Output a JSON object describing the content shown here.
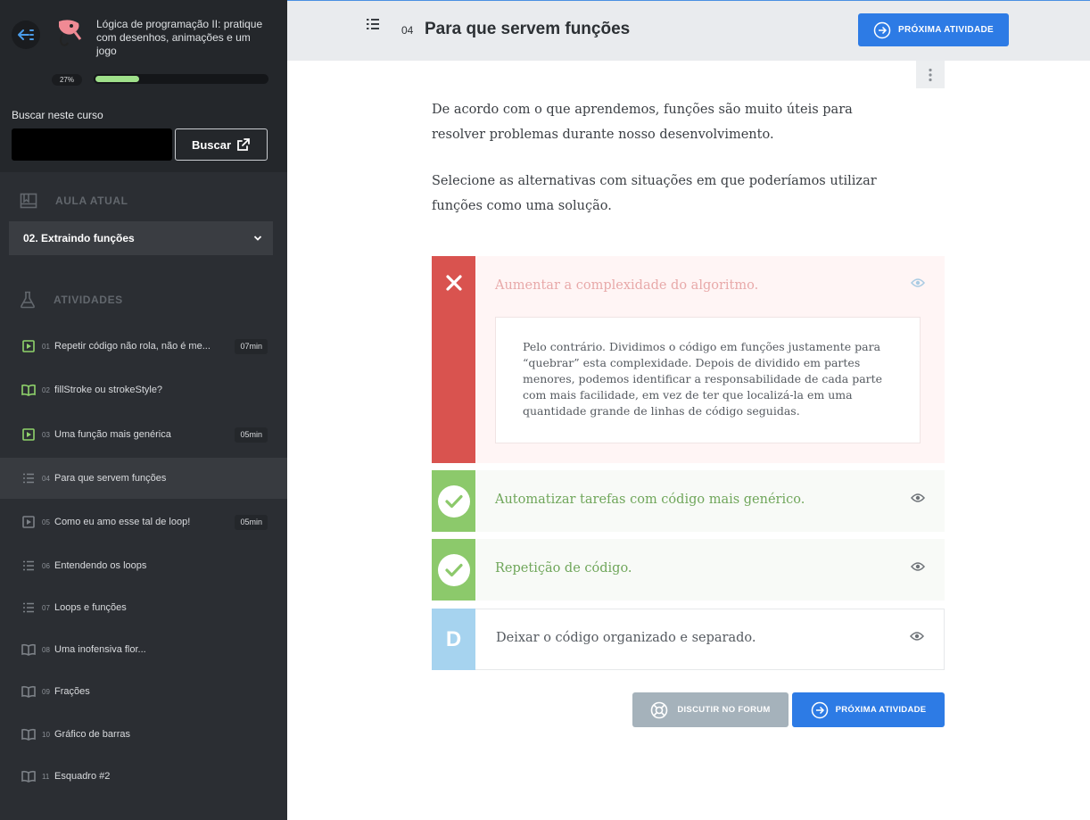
{
  "sidebar": {
    "back_icon": "back-arrow-icon",
    "course_title": "Lógica de programação II: pratique com desenhos, animações e um jogo",
    "progress_label": "27%",
    "progress_value": 0.27,
    "search_label": "Buscar neste curso",
    "search_value": "",
    "search_button": "Buscar",
    "current_lesson_heading": "AULA ATUAL",
    "current_lesson": "02. Extraindo funções",
    "activities_heading": "ATIVIDADES",
    "activities": [
      {
        "num": "01",
        "name": "Repetir código não rola, não é me...",
        "duration": "07min",
        "icon": "video-icon",
        "done": true
      },
      {
        "num": "02",
        "name": "fillStroke ou strokeStyle?",
        "duration": "",
        "icon": "book-icon",
        "done": true
      },
      {
        "num": "03",
        "name": "Uma função mais genérica",
        "duration": "05min",
        "icon": "video-icon",
        "done": true
      },
      {
        "num": "04",
        "name": "Para que servem funções",
        "duration": "",
        "icon": "list-icon",
        "done": false
      },
      {
        "num": "05",
        "name": "Como eu amo esse tal de loop!",
        "duration": "05min",
        "icon": "video-icon",
        "done": false
      },
      {
        "num": "06",
        "name": "Entendendo os loops",
        "duration": "",
        "icon": "list-icon",
        "done": false
      },
      {
        "num": "07",
        "name": "Loops e funções",
        "duration": "",
        "icon": "list-icon",
        "done": false
      },
      {
        "num": "08",
        "name": "Uma inofensiva flor...",
        "duration": "",
        "icon": "book-icon",
        "done": false
      },
      {
        "num": "09",
        "name": "Frações",
        "duration": "",
        "icon": "book-icon",
        "done": false
      },
      {
        "num": "10",
        "name": "Gráfico de barras",
        "duration": "",
        "icon": "book-icon",
        "done": false
      },
      {
        "num": "11",
        "name": "Esquadro #2",
        "duration": "",
        "icon": "book-icon",
        "done": false
      }
    ]
  },
  "header": {
    "activity_number": "04",
    "title": "Para que servem funções",
    "next_button": "PRÓXIMA ATIVIDADE"
  },
  "main": {
    "intro": "De acordo com o que aprendemos, funções são muito úteis para resolver problemas durante nosso desenvolvimento.",
    "instruction": "Selecione as alternativas com situações em que poderíamos utilizar funções como uma solução.",
    "options": [
      {
        "marker": "✕",
        "state": "wrong",
        "text": "Aumentar a complexidade do algoritmo.",
        "feedback": "Pelo contrário. Dividimos o código em funções justamente para “quebrar” esta complexidade. Depois de dividido em partes menores, podemos identificar a responsabilidade de cada parte com mais facilidade, em vez de ter que localizá-la em uma quantidade grande de linhas de código seguidas."
      },
      {
        "marker": "✓",
        "state": "correct",
        "text": "Automatizar tarefas com código mais genérico."
      },
      {
        "marker": "✓",
        "state": "correct",
        "text": "Repetição de código."
      },
      {
        "marker": "D",
        "state": "unanswered",
        "text": "Deixar o código organizado e separado."
      }
    ],
    "forum_button": "DISCUTIR NO FORUM",
    "next_button": "PRÓXIMA ATIVIDADE"
  },
  "colors": {
    "sidebar_bg": "#2b2e33",
    "accent_blue": "#2d7be5",
    "wrong_red": "#d9534f",
    "correct_green": "#8cc96b",
    "neutral_blue": "#a6d3ef",
    "progress_green": "#9fe08a"
  }
}
